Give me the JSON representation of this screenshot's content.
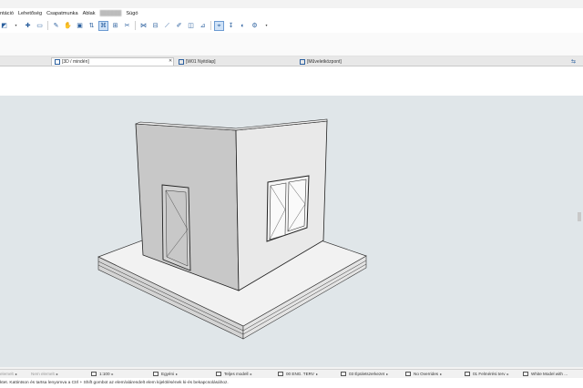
{
  "menu": [
    "ntáció",
    "Lehetőség",
    "Csapatmunka",
    "Ablak",
    "██████",
    "Súgó"
  ],
  "toolbar": {
    "icons": [
      "layers-icon",
      "cursor-icon",
      "marquee-icon",
      "eyedropper-icon",
      "hand-icon",
      "paint-icon",
      "arrange-icon",
      "magic-wand-icon",
      "grid-icon",
      "trim-icon",
      "intersect-icon",
      "split-icon",
      "adjust-icon",
      "pencil-icon",
      "snap-icon",
      "guide-icon",
      "target-icon",
      "drop-icon",
      "render-icon"
    ]
  },
  "tabs": [
    {
      "label": "[3D / mindén]",
      "active": true
    },
    {
      "label": "[W01 Nyitólap]",
      "active": false
    },
    {
      "label": "[Műveletközpont]",
      "active": false
    }
  ],
  "status": {
    "items": [
      {
        "label": "elemelt",
        "dim": true
      },
      {
        "label": "Nem elemelt",
        "dim": true
      },
      {
        "label": "1:100"
      },
      {
        "label": "Egyéni"
      },
      {
        "label": "Teljes modell"
      },
      {
        "label": "00 ENG. TERV"
      },
      {
        "label": "03 Épületszerkezet"
      },
      {
        "label": "No Overrides"
      },
      {
        "label": "01 Felmérési terv"
      },
      {
        "label": "White Model with ..."
      }
    ]
  },
  "hint": "ktet. Kattintson és tartsa lenyomva a Ctrl + Shift gombot az elem/alárendelt elem kijelölésének ki-és bekapcsolásához.",
  "colors": {
    "accent": "#2a5f9e",
    "viewport_bg": "#e0e6e9",
    "wall_left": "#cacaca",
    "wall_right": "#e8e8e8",
    "slab_top": "#f2f2f2"
  }
}
